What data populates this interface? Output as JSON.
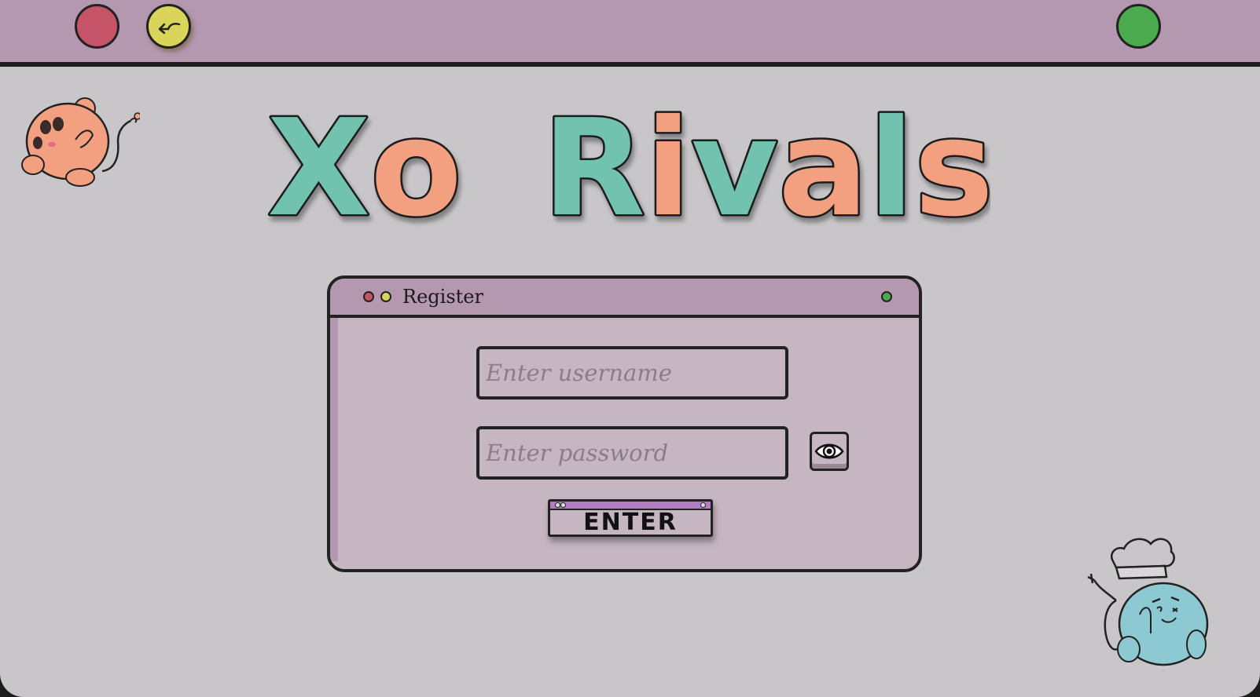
{
  "app": {
    "title_word_1": "Xo",
    "title_word_2": "Rivals"
  },
  "colors": {
    "titlebar": "#b498b0",
    "background": "#c8c6c8",
    "close": "#c55468",
    "back": "#d8d55a",
    "maximize": "#4caa4e",
    "logo_teal": "#72c2b0",
    "logo_orange": "#f2a080"
  },
  "icons": {
    "back": "back-arrow-icon",
    "eye": "eye-icon",
    "mascot_left": "orange-ghost-mascot",
    "mascot_right": "chef-cat-mascot"
  },
  "register": {
    "title": "Register",
    "username_placeholder": "Enter username",
    "password_placeholder": "Enter password",
    "enter_label": "ENTER"
  }
}
